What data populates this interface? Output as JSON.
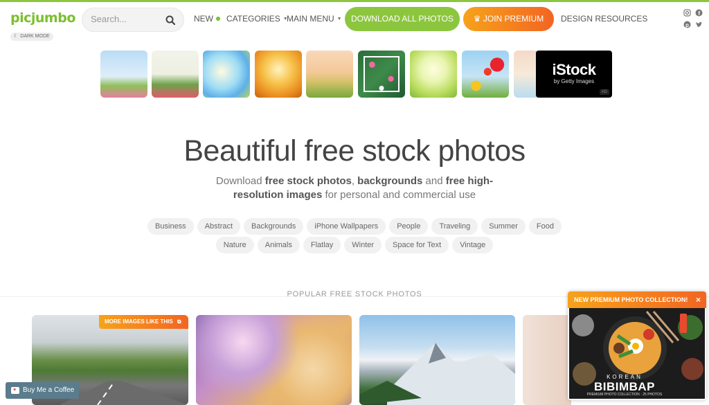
{
  "header": {
    "logo": "picjumbo",
    "dark_mode_label": "DARK MODE",
    "search_placeholder": "Search...",
    "nav": {
      "new_label": "NEW",
      "categories_label": "CATEGORIES",
      "main_menu_label": "MAIN MENU",
      "download_all_label": "DOWNLOAD ALL PHOTOS",
      "join_premium_label": "JOIN PREMIUM",
      "design_resources_label": "DESIGN RESOURCES"
    },
    "social": [
      "instagram-icon",
      "facebook-icon",
      "pinterest-icon",
      "twitter-icon"
    ]
  },
  "ad_strip": {
    "istock_title": "iStock",
    "istock_subtitle": "by Getty Images",
    "ad_label": "AD"
  },
  "hero": {
    "title": "Beautiful free stock photos",
    "sub_1": "Download ",
    "sub_b1": "free stock photos",
    "sub_2": ", ",
    "sub_b2": "backgrounds",
    "sub_3": " and ",
    "sub_b3": "free high-resolution images",
    "sub_4": " for personal and commercial use"
  },
  "tags_row1": [
    "Business",
    "Abstract",
    "Backgrounds",
    "iPhone Wallpapers",
    "People",
    "Traveling",
    "Summer",
    "Food"
  ],
  "tags_row2": [
    "Nature",
    "Animals",
    "Flatlay",
    "Winter",
    "Space for Text",
    "Vintage"
  ],
  "popular": {
    "title": "POPULAR FREE STOCK PHOTOS",
    "more_images_label": "MORE IMAGES LIKE THIS"
  },
  "coffee_label": "Buy Me a Coffee",
  "promo": {
    "header": "NEW PREMIUM PHOTO COLLECTION!",
    "close": "×",
    "line1": "KOREAN",
    "line2": "BIBIMBAP",
    "line3": "PREMIUM PHOTO COLLECTION · 25 PHOTOS"
  },
  "colors": {
    "brand_green": "#8cc63f",
    "premium_orange": "#f26522"
  }
}
